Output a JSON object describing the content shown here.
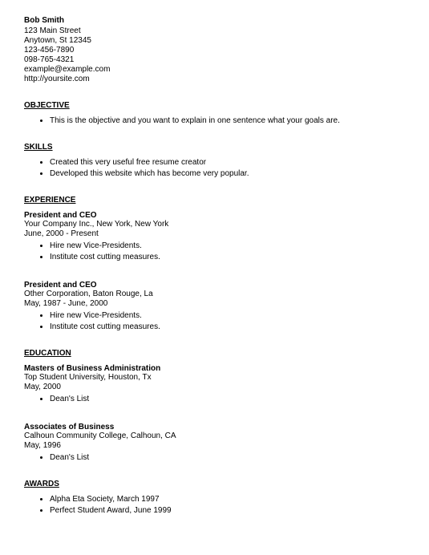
{
  "header": {
    "name": "Bob Smith",
    "address": "123 Main Street",
    "citystate": "Anytown, St 12345",
    "phone1": "123-456-7890",
    "phone2": "098-765-4321",
    "email": "example@example.com",
    "website": "http://yoursite.com"
  },
  "sections": {
    "objective": {
      "title": "OBJECTIVE",
      "items": [
        "This is the objective and you want to explain in one sentence what your goals are."
      ]
    },
    "skills": {
      "title": "SKILLS",
      "items": [
        "Created this very useful free resume creator",
        "Developed this website which has become very popular."
      ]
    },
    "experience": {
      "title": "EXPERIENCE",
      "jobs": [
        {
          "title": "President and CEO",
          "company": "Your Company Inc., New York, New York",
          "dates": "June, 2000 - Present",
          "bullets": [
            "Hire new Vice-Presidents.",
            "Institute cost cutting measures."
          ]
        },
        {
          "title": "President and CEO",
          "company": "Other Corporation, Baton Rouge, La",
          "dates": "May, 1987 - June, 2000",
          "bullets": [
            "Hire new Vice-Presidents.",
            "Institute cost cutting measures."
          ]
        }
      ]
    },
    "education": {
      "title": "EDUCATION",
      "schools": [
        {
          "degree": "Masters of Business Administration",
          "school": "Top Student University, Houston, Tx",
          "dates": "May, 2000",
          "bullets": [
            "Dean's List"
          ]
        },
        {
          "degree": "Associates of Business",
          "school": "Calhoun Community College, Calhoun, CA",
          "dates": "May, 1996",
          "bullets": [
            "Dean's List"
          ]
        }
      ]
    },
    "awards": {
      "title": "AWARDS",
      "items": [
        "Alpha Eta Society, March 1997",
        "Perfect Student Award, June 1999"
      ]
    }
  }
}
